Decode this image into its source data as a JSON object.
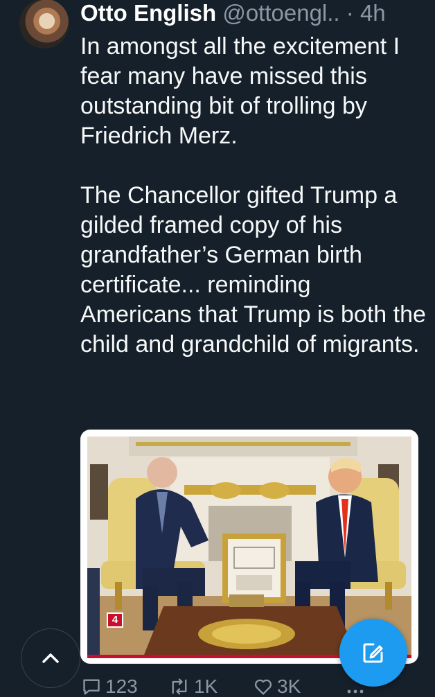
{
  "tweet": {
    "author_name": "Otto English",
    "handle": "@ottoengl..",
    "separator": "·",
    "time": "4h",
    "paragraphs": [
      "In amongst all the excitement I fear many have missed this outstanding bit of trolling by Friedrich Merz.",
      "The Chancellor gifted Trump a gilded framed copy of his grandfather’s German birth certificate... reminding Americans that Trump is both the child and grandchild of migrants."
    ],
    "media": {
      "badge": "4"
    },
    "actions": {
      "replies": "123",
      "retweets": "1K",
      "likes": "3K"
    }
  },
  "icons": {
    "up": "chevron-up-icon",
    "compose": "compose-icon",
    "reply": "reply-icon",
    "retweet": "retweet-icon",
    "like": "heart-icon",
    "more": "more-icon"
  },
  "colors": {
    "background": "#15202b",
    "secondary_text": "#8b98a5",
    "accent": "#1d9bf0",
    "badge_red": "#c8102e"
  }
}
